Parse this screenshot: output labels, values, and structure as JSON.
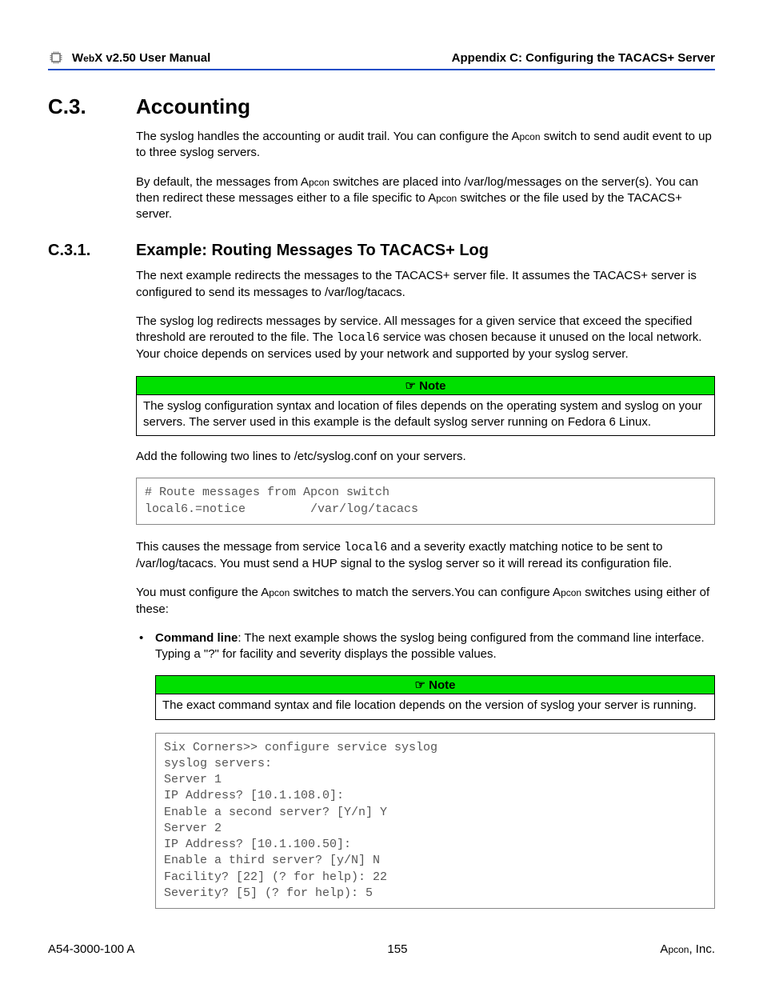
{
  "header": {
    "manual_prefix": "W",
    "manual_mid": "eb",
    "manual_end": "X v2.50 User Manual",
    "appendix": "Appendix C: Configuring the TACACS+ Server"
  },
  "section": {
    "num": "C.3.",
    "title": "Accounting",
    "p1a": "The syslog handles the accounting or audit trail. You can configure the A",
    "p1b": "pcon",
    "p1c": " switch to send audit event to up to three syslog servers.",
    "p2a": "By default, the messages from A",
    "p2b": "pcon",
    "p2c": " switches are placed into /var/log/messages on the server(s). You can then redirect these messages either to a file specific to A",
    "p2d": "pcon",
    "p2e": " switches or the file used by the TACACS+ server."
  },
  "subsection": {
    "num": "C.3.1.",
    "title": "Example: Routing Messages To TACACS+ Log",
    "p1": "The next example redirects the messages to the TACACS+ server file. It assumes the TACACS+ server is configured to send its messages to /var/log/tacacs.",
    "p2a": "The syslog log redirects messages by service. All messages for a given service that exceed the specified threshold are rerouted to the file. The ",
    "p2_code": "local6",
    "p2b": " service was chosen because it unused on the local network. Your choice depends on services used by your network and supported by your syslog server.",
    "note1_label": "Note",
    "note1_body": "The syslog configuration syntax and location of files depends on the operating system and syslog on your servers. The server used in this example is the default syslog server running on Fedora 6 Linux.",
    "p3": "Add the following two lines to /etc/syslog.conf on your servers.",
    "code1": "# Route messages from Apcon switch\nlocal6.=notice         /var/log/tacacs",
    "p4a": "This causes the message from service ",
    "p4_code": "local6",
    "p4b": " and a severity exactly matching notice to be sent to /var/log/tacacs. You must send a HUP signal to the syslog server so it will reread its configuration file.",
    "p5a": "You must configure the A",
    "p5b": "pcon",
    "p5c": " switches to match the servers.You can configure A",
    "p5d": "pcon",
    "p5e": " switches using either of these:",
    "bullet_label": "Command line",
    "bullet_text": ": The next example shows the syslog being configured from the command line interface. Typing a \"?\" for facility and severity displays the possible values.",
    "note2_label": "Note",
    "note2_body": "The exact command syntax and file location depends on the version of syslog your server is running.",
    "code2": "Six Corners>> configure service syslog\nsyslog servers:\nServer 1\nIP Address? [10.1.108.0]:\nEnable a second server? [Y/n] Y\nServer 2\nIP Address? [10.1.100.50]:\nEnable a third server? [y/N] N\nFacility? [22] (? for help): 22\nSeverity? [5] (? for help): 5"
  },
  "footer": {
    "left": "A54-3000-100 A",
    "center": "155",
    "right_a": "A",
    "right_b": "pcon",
    "right_c": ", Inc."
  }
}
